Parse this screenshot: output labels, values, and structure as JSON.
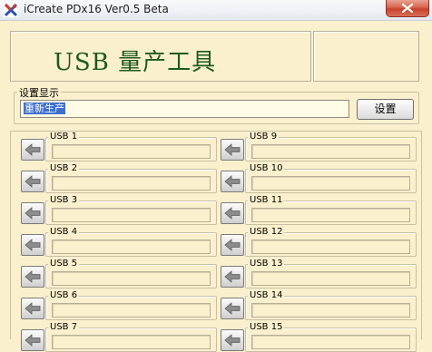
{
  "window": {
    "title": "iCreate PDx16 Ver0.5 Beta"
  },
  "banner": {
    "title": "USB 量产工具"
  },
  "settings": {
    "group_label": "设置显示",
    "current_value": "重新生产",
    "button_label": "设置"
  },
  "ports": {
    "left": [
      {
        "label": "USB 1",
        "value": ""
      },
      {
        "label": "USB 2",
        "value": ""
      },
      {
        "label": "USB 3",
        "value": ""
      },
      {
        "label": "USB 4",
        "value": ""
      },
      {
        "label": "USB 5",
        "value": ""
      },
      {
        "label": "USB 6",
        "value": ""
      },
      {
        "label": "USB 7",
        "value": ""
      }
    ],
    "right": [
      {
        "label": "USB 9",
        "value": ""
      },
      {
        "label": "USB 10",
        "value": ""
      },
      {
        "label": "USB 11",
        "value": ""
      },
      {
        "label": "USB 12",
        "value": ""
      },
      {
        "label": "USB 13",
        "value": ""
      },
      {
        "label": "USB 14",
        "value": ""
      },
      {
        "label": "USB 15",
        "value": ""
      }
    ]
  },
  "colors": {
    "background": "#fbf0cd",
    "banner_text": "#1e5a1e",
    "selection": "#3f6fcc"
  },
  "icons": {
    "app": "app-icon",
    "close": "close-icon",
    "port_action": "arrow-left-icon"
  }
}
